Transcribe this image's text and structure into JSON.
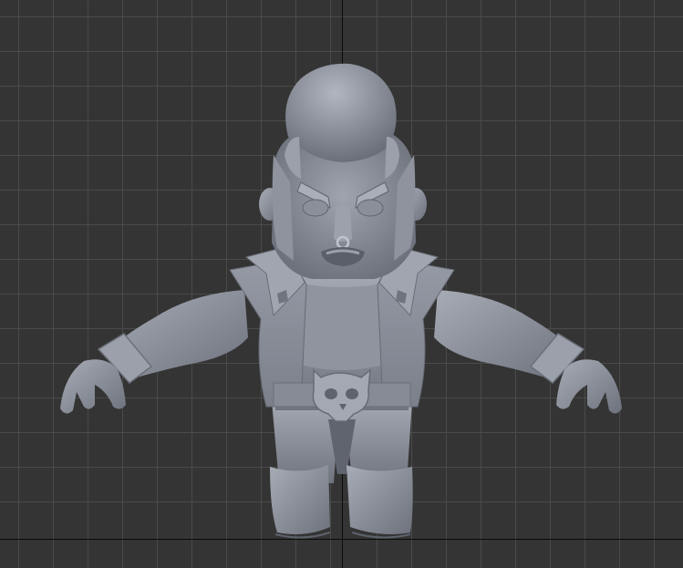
{
  "viewport": {
    "kind": "3d-modeling-viewport",
    "view": "front-orthographic",
    "background_color": "#343434",
    "grid": {
      "shown": true,
      "line_color": "#4a4a4a",
      "axis_color": "#0a0a0a"
    },
    "model": {
      "pose": "T-pose",
      "material": "clay",
      "base_color": "#8d939f",
      "parts": [
        "pompadour-hair",
        "head",
        "nose-ring",
        "open-jacket",
        "skull-belt-buckle",
        "arms",
        "cuffed-sleeves",
        "hands",
        "pants",
        "boots"
      ]
    }
  }
}
